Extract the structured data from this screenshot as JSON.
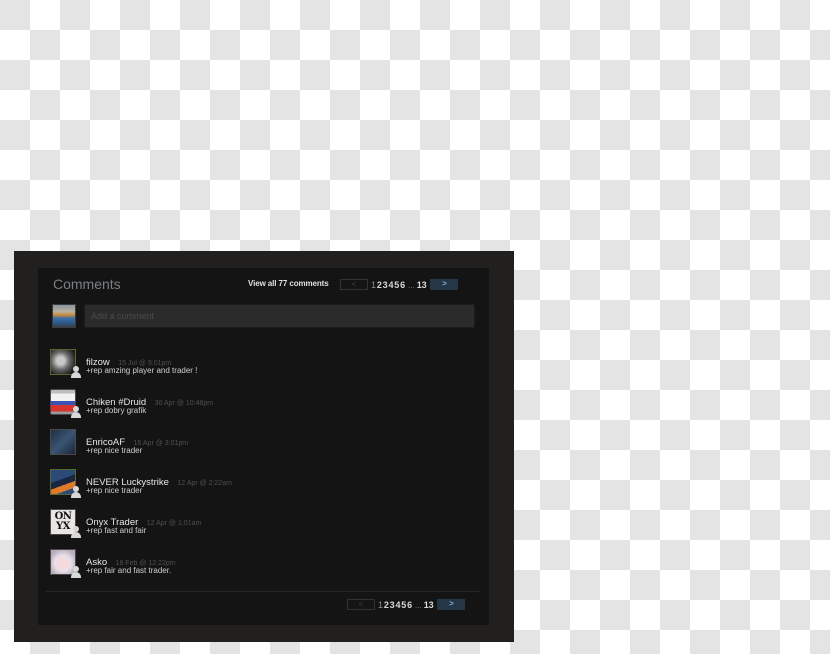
{
  "header": {
    "title": "Comments",
    "view_all": "View all 77 comments"
  },
  "pagination": {
    "prev_label": "<",
    "next_label": ">",
    "current_page": "1",
    "pages": [
      "2",
      "3",
      "4",
      "5",
      "6"
    ],
    "ellipsis": "...",
    "last_page": "13"
  },
  "composer": {
    "placeholder": "Add a comment",
    "avatar_icon": "user-avatar"
  },
  "comments": [
    {
      "author": "filzow",
      "timestamp": "15 Jul @ 9:01pm",
      "text": "+rep amzing player and trader !",
      "status": "online",
      "friend_icon": true
    },
    {
      "author": "Chiken #Druid",
      "timestamp": "30 Apr @ 10:48pm",
      "text": "+rep dobry grafik",
      "status": "offline",
      "friend_icon": true
    },
    {
      "author": "EnricoAF",
      "timestamp": "16 Apr @ 3:01pm",
      "text": "+rep nice trader",
      "status": "offline",
      "friend_icon": false
    },
    {
      "author": "NEVER Luckystrike",
      "timestamp": "12 Apr @ 2:22am",
      "text": "+rep nice trader",
      "status": "online",
      "friend_icon": true
    },
    {
      "author": "Onyx Trader",
      "timestamp": "12 Apr @ 1:01am",
      "text": "+rep fast and fair",
      "status": "offline",
      "friend_icon": true,
      "avatar_text": "ON YX"
    },
    {
      "author": "Asko",
      "timestamp": "18 Feb @ 12:22pm",
      "text": "+rep fair and fast trader.",
      "status": "offline",
      "friend_icon": true
    }
  ],
  "colors": {
    "panel_bg": "#141414",
    "frame_bg": "#221f1f",
    "next_button_bg": "#253646",
    "next_button_fg": "#7fb3d9",
    "online_border": "#55692c"
  }
}
